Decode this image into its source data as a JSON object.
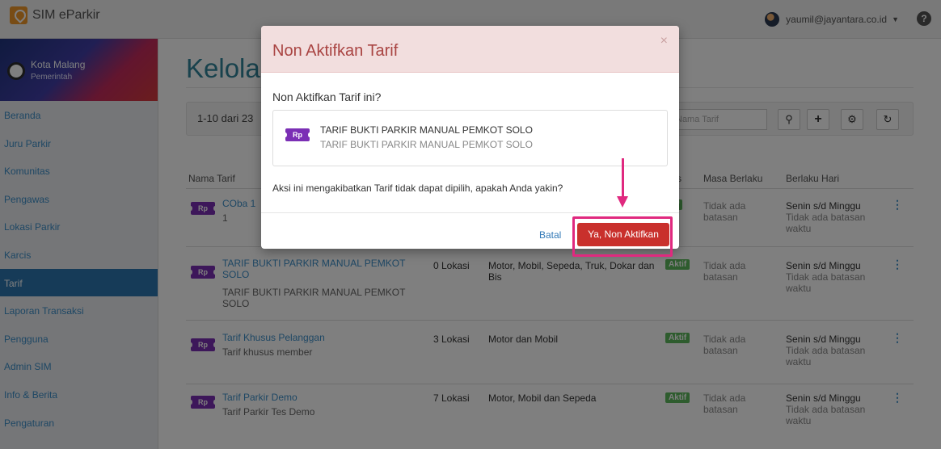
{
  "app": {
    "name": "SIM eParkir"
  },
  "user": {
    "email": "yaumil@jayantara.co.id"
  },
  "org": {
    "name": "Kota Malang",
    "type": "Pemerintah"
  },
  "sidebar": {
    "items": [
      {
        "label": "Beranda"
      },
      {
        "label": "Juru Parkir"
      },
      {
        "label": "Komunitas"
      },
      {
        "label": "Pengawas"
      },
      {
        "label": "Lokasi Parkir"
      },
      {
        "label": "Karcis"
      },
      {
        "label": "Tarif"
      },
      {
        "label": "Laporan Transaksi"
      },
      {
        "label": "Pengguna"
      },
      {
        "label": "Admin SIM"
      },
      {
        "label": "Info & Berita"
      },
      {
        "label": "Pengaturan"
      }
    ],
    "active": "Tarif"
  },
  "page": {
    "title": "Kelola"
  },
  "toolbar": {
    "pager": "1-10 dari 23",
    "search_placeholder": "Nama Tarif"
  },
  "table": {
    "headers": [
      "Nama Tarif",
      "tus",
      "Masa Berlaku",
      "Berlaku Hari"
    ],
    "rows": [
      {
        "name": "COba 1",
        "sub": "1",
        "badge": "Rp",
        "location": "",
        "vehicles": "",
        "status": "tif",
        "validity": "Tidak ada batasan",
        "days": "Senin s/d Minggu",
        "days_sub": "Tidak ada batasan waktu"
      },
      {
        "name": "TARIF BUKTI PARKIR MANUAL PEMKOT SOLO",
        "sub": "TARIF BUKTI PARKIR MANUAL PEMKOT SOLO",
        "badge": "Rp",
        "location": "0 Lokasi",
        "vehicles": "Motor, Mobil, Sepeda, Truk, Dokar dan Bis",
        "status": "Aktif",
        "validity": "Tidak ada batasan",
        "days": "Senin s/d Minggu",
        "days_sub": "Tidak ada batasan waktu"
      },
      {
        "name": "Tarif Khusus Pelanggan",
        "sub": "Tarif khusus member",
        "badge": "Rp",
        "location": "3 Lokasi",
        "vehicles": "Motor dan Mobil",
        "status": "Aktif",
        "validity": "Tidak ada batasan",
        "days": "Senin s/d Minggu",
        "days_sub": "Tidak ada batasan waktu"
      },
      {
        "name": "Tarif Parkir Demo",
        "sub": "Tarif Parkir Tes Demo",
        "badge": "Rp",
        "location": "7 Lokasi",
        "vehicles": "Motor, Mobil dan Sepeda",
        "status": "Aktif",
        "validity": "Tidak ada batasan",
        "days": "Senin s/d Minggu",
        "days_sub": "Tidak ada batasan waktu"
      }
    ]
  },
  "modal": {
    "title": "Non Aktifkan Tarif",
    "close": "×",
    "question": "Non Aktifkan Tarif ini?",
    "tariff_name": "TARIF BUKTI PARKIR MANUAL PEMKOT SOLO",
    "tariff_desc": "TARIF BUKTI PARKIR MANUAL PEMKOT SOLO",
    "badge": "Rp",
    "warning": "Aksi ini mengakibatkan Tarif tidak dapat dipilih, apakah Anda yakin?",
    "cancel_label": "Batal",
    "confirm_label": "Ya, Non Aktifkan"
  },
  "colors": {
    "brand_orange": "#f0982b",
    "title_teal": "#30859b",
    "sidebar_active": "#2d76b0",
    "status_green": "#5cb85c",
    "danger_red": "#c9302c",
    "annotation_pink": "#e0297f"
  },
  "icons": {
    "brand": "map-pin-icon",
    "help": "question-circle-icon",
    "search": "search-icon",
    "add": "plus-icon",
    "settings": "gear-icon",
    "refresh": "refresh-icon",
    "row_menu": "kebab-icon"
  }
}
